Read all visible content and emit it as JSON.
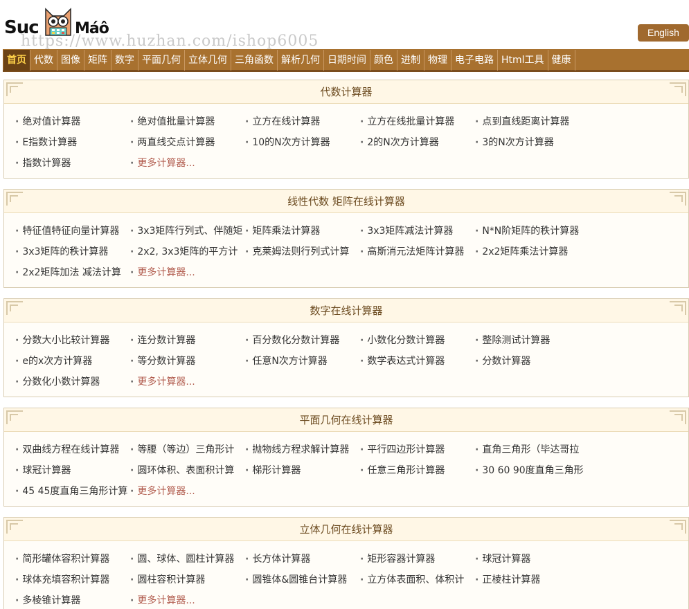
{
  "header": {
    "brand_left": "Suc",
    "brand_right": "Máô",
    "watermark": "https://www.huzhan.com/ishop6005",
    "lang_button": "English"
  },
  "nav": [
    "首页",
    "代数",
    "图像",
    "矩阵",
    "数字",
    "平面几何",
    "立体几何",
    "三角函数",
    "解析几何",
    "日期时间",
    "颜色",
    "进制",
    "物理",
    "电子电路",
    "Html工具",
    "健康"
  ],
  "sections": [
    {
      "title": "代数计算器",
      "rows": [
        [
          "绝对值计算器",
          "绝对值批量计算器",
          "立方在线计算器",
          "立方在线批量计算器",
          "点到直线距离计算器"
        ],
        [
          "E指数计算器",
          "两直线交点计算器",
          "10的N次方计算器",
          "2的N次方计算器",
          "3的N次方计算器"
        ],
        [
          "指数计算器",
          "更多计算器..."
        ]
      ]
    },
    {
      "title": "线性代数 矩阵在线计算器",
      "rows": [
        [
          "特征值特征向量计算器",
          "3x3矩阵行列式、伴随矩",
          "矩阵乘法计算器",
          "3x3矩阵减法计算器",
          "N*N阶矩阵的秩计算器"
        ],
        [
          "3x3矩阵的秩计算器",
          "2x2, 3x3矩阵的平方计",
          "克莱姆法则行列式计算",
          "高斯消元法矩阵计算器",
          "2x2矩阵乘法计算器"
        ],
        [
          "2x2矩阵加法 减法计算",
          "更多计算器..."
        ]
      ]
    },
    {
      "title": "数字在线计算器",
      "rows": [
        [
          "分数大小比较计算器",
          "连分数计算器",
          "百分数化分数计算器",
          "小数化分数计算器",
          "整除测试计算器"
        ],
        [
          "e的x次方计算器",
          "等分数计算器",
          "任意N次方计算器",
          "数学表达式计算器",
          "分数计算器"
        ],
        [
          "分数化小数计算器",
          "更多计算器..."
        ]
      ]
    },
    {
      "title": "平面几何在线计算器",
      "rows": [
        [
          "双曲线方程在线计算器",
          "等腰（等边）三角形计",
          "抛物线方程求解计算器",
          "平行四边形计算器",
          "直角三角形（毕达哥拉"
        ],
        [
          "球冠计算器",
          "圆环体积、表面积计算",
          "梯形计算器",
          "任意三角形计算器",
          "30 60 90度直角三角形"
        ],
        [
          "45 45度直角三角形计算",
          "更多计算器..."
        ]
      ]
    },
    {
      "title": "立体几何在线计算器",
      "rows": [
        [
          "简形罐体容积计算器",
          "圆、球体、圆柱计算器",
          "长方体计算器",
          "矩形容器计算器",
          "球冠计算器"
        ],
        [
          "球体充填容积计算器",
          "圆柱容积计算器",
          "圆锥体&圆锥台计算器",
          "立方体表面积、体积计",
          "正棱柱计算器"
        ],
        [
          "多棱锥计算器",
          "更多计算器..."
        ]
      ]
    }
  ]
}
